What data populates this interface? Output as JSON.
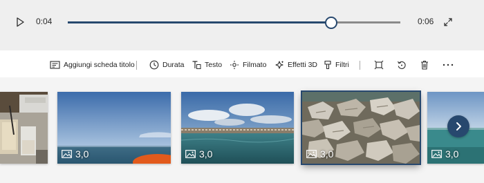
{
  "player": {
    "current_time": "0:04",
    "end_time": "0:06",
    "progress_percent": 79,
    "accent_color": "#27486e"
  },
  "toolbar": {
    "add_title_card": "Aggiungi scheda titolo",
    "duration": "Durata",
    "text": "Testo",
    "motion": "Filmato",
    "effects_3d": "Effetti 3D",
    "filters": "Filtri",
    "icons": [
      "title-card-icon",
      "clock-icon",
      "text-icon",
      "motion-icon",
      "effects-3d-icon",
      "filter-icon",
      "resize-icon",
      "rotate-icon",
      "trash-icon",
      "more-icon"
    ]
  },
  "storyboard": {
    "clips": [
      {
        "scene": "drinks-table",
        "duration": ""
      },
      {
        "scene": "sea-sky",
        "duration": "3,0"
      },
      {
        "scene": "sea-shore-clouds",
        "duration": "3,0"
      },
      {
        "scene": "rocks",
        "duration": "3,0",
        "selected": true
      },
      {
        "scene": "sea-partial",
        "duration": "3,0"
      }
    ],
    "next_icon": "chevron-right-icon"
  }
}
